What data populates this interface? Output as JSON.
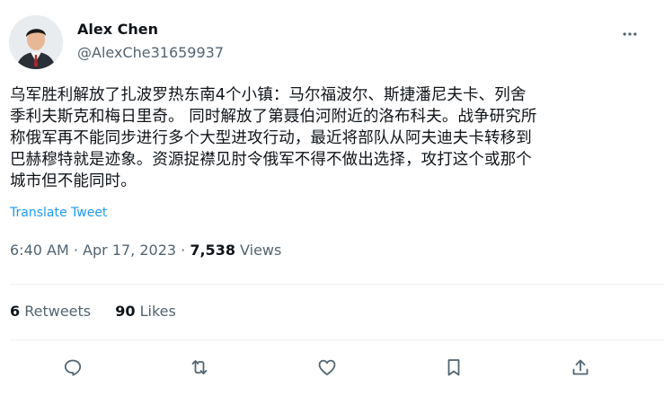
{
  "author": {
    "display_name": "Alex Chen",
    "handle": "@AlexChe31659937"
  },
  "tweet": {
    "text": "乌军胜利解放了扎波罗热东南4个小镇：马尔福波尔、斯捷潘尼夫卡、列舍\n季利夫斯克和梅日里奇。 同时解放了第聂伯河附近的洛布科夫。战争研究所\n称俄军再不能同步进行多个大型进攻行动，最近将部队从阿夫迪夫卡转移到\n巴赫穆特就是迹象。资源捉襟见肘令俄军不得不做出选择，攻打这个或那个\n城市但不能同时。",
    "translate_label": "Translate Tweet",
    "time": "6:40 AM",
    "date": "Apr 17, 2023",
    "separator": "·",
    "views_count": "7,538",
    "views_label": "Views"
  },
  "stats": {
    "retweets_count": "6",
    "retweets_label": "Retweets",
    "likes_count": "90",
    "likes_label": "Likes"
  },
  "icons": {
    "more": "more-dots-icon",
    "reply": "reply-bubble-icon",
    "retweet": "retweet-icon",
    "like": "heart-icon",
    "bookmark": "bookmark-icon",
    "share": "share-upload-icon"
  },
  "colors": {
    "text": "#0f1419",
    "secondary": "#536471",
    "link": "#1d9bf0",
    "divider": "#eff3f4"
  }
}
